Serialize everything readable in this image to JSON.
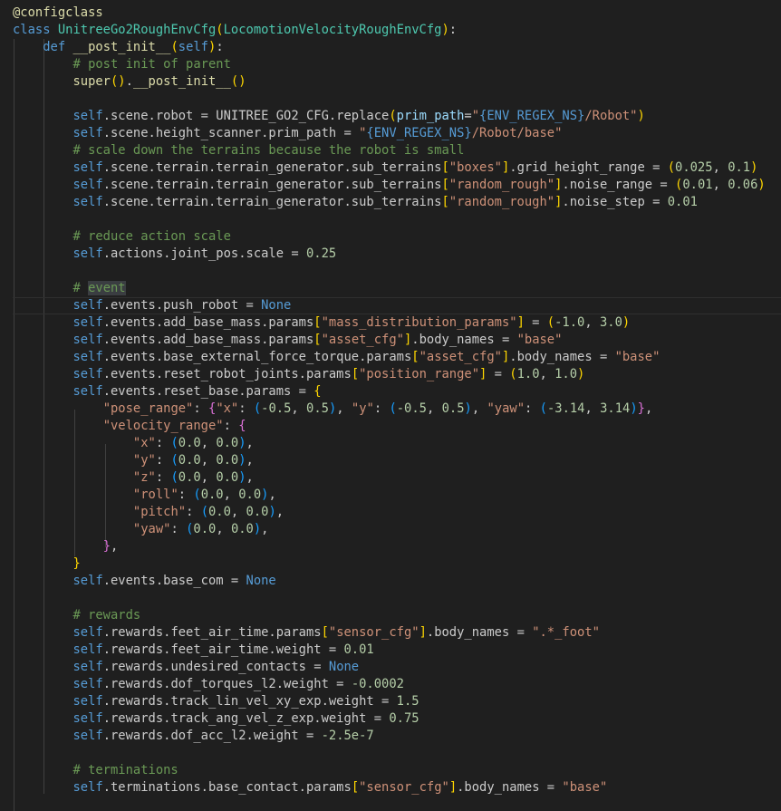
{
  "colors": {
    "background": "#1f1f1f",
    "text": "#cccccc",
    "keyword": "#569cd6",
    "class_name": "#4ec9b0",
    "function": "#dcdcaa",
    "string": "#ce9178",
    "number": "#b5cea8",
    "comment": "#6a9955",
    "bracket_1": "#ffd700",
    "bracket_2": "#da70d6",
    "bracket_3": "#179fff"
  },
  "code": {
    "language": "python",
    "highlighted_line": 17,
    "lines": [
      [
        {
          "t": "dec",
          "v": "@configclass"
        }
      ],
      [
        {
          "t": "kw",
          "v": "class "
        },
        {
          "t": "cls",
          "v": "UnitreeGo2RoughEnvCfg"
        },
        {
          "t": "p1",
          "v": "("
        },
        {
          "t": "cls",
          "v": "LocomotionVelocityRoughEnvCfg"
        },
        {
          "t": "p1",
          "v": ")"
        },
        {
          "t": "op",
          "v": ":"
        }
      ],
      [
        {
          "t": "txt",
          "v": "    "
        },
        {
          "t": "kw",
          "v": "def "
        },
        {
          "t": "fn",
          "v": "__post_init__"
        },
        {
          "t": "p1",
          "v": "("
        },
        {
          "t": "self",
          "v": "self"
        },
        {
          "t": "p1",
          "v": ")"
        },
        {
          "t": "op",
          "v": ":"
        }
      ],
      [
        {
          "t": "txt",
          "v": "        "
        },
        {
          "t": "cmt",
          "v": "# post init of parent"
        }
      ],
      [
        {
          "t": "txt",
          "v": "        "
        },
        {
          "t": "fn",
          "v": "super"
        },
        {
          "t": "p1",
          "v": "()"
        },
        {
          "t": "op",
          "v": "."
        },
        {
          "t": "fn",
          "v": "__post_init__"
        },
        {
          "t": "p1",
          "v": "()"
        }
      ],
      [],
      [
        {
          "t": "txt",
          "v": "        "
        },
        {
          "t": "self",
          "v": "self"
        },
        {
          "t": "txt",
          "v": ".scene.robot = UNITREE_GO2_CFG.replace"
        },
        {
          "t": "p1",
          "v": "("
        },
        {
          "t": "param",
          "v": "prim_path"
        },
        {
          "t": "op",
          "v": "="
        },
        {
          "t": "str",
          "v": "\""
        },
        {
          "t": "esc",
          "v": "{ENV_REGEX_NS}"
        },
        {
          "t": "str",
          "v": "/Robot\""
        },
        {
          "t": "p1",
          "v": ")"
        }
      ],
      [
        {
          "t": "txt",
          "v": "        "
        },
        {
          "t": "self",
          "v": "self"
        },
        {
          "t": "txt",
          "v": ".scene.height_scanner.prim_path = "
        },
        {
          "t": "str",
          "v": "\""
        },
        {
          "t": "esc",
          "v": "{ENV_REGEX_NS}"
        },
        {
          "t": "str",
          "v": "/Robot/base\""
        }
      ],
      [
        {
          "t": "txt",
          "v": "        "
        },
        {
          "t": "cmt",
          "v": "# scale down the terrains because the robot is small"
        }
      ],
      [
        {
          "t": "txt",
          "v": "        "
        },
        {
          "t": "self",
          "v": "self"
        },
        {
          "t": "txt",
          "v": ".scene.terrain.terrain_generator.sub_terrains"
        },
        {
          "t": "p1",
          "v": "["
        },
        {
          "t": "str",
          "v": "\"boxes\""
        },
        {
          "t": "p1",
          "v": "]"
        },
        {
          "t": "txt",
          "v": ".grid_height_range = "
        },
        {
          "t": "p1",
          "v": "("
        },
        {
          "t": "num",
          "v": "0.025"
        },
        {
          "t": "txt",
          "v": ", "
        },
        {
          "t": "num",
          "v": "0.1"
        },
        {
          "t": "p1",
          "v": ")"
        }
      ],
      [
        {
          "t": "txt",
          "v": "        "
        },
        {
          "t": "self",
          "v": "self"
        },
        {
          "t": "txt",
          "v": ".scene.terrain.terrain_generator.sub_terrains"
        },
        {
          "t": "p1",
          "v": "["
        },
        {
          "t": "str",
          "v": "\"random_rough\""
        },
        {
          "t": "p1",
          "v": "]"
        },
        {
          "t": "txt",
          "v": ".noise_range = "
        },
        {
          "t": "p1",
          "v": "("
        },
        {
          "t": "num",
          "v": "0.01"
        },
        {
          "t": "txt",
          "v": ", "
        },
        {
          "t": "num",
          "v": "0.06"
        },
        {
          "t": "p1",
          "v": ")"
        }
      ],
      [
        {
          "t": "txt",
          "v": "        "
        },
        {
          "t": "self",
          "v": "self"
        },
        {
          "t": "txt",
          "v": ".scene.terrain.terrain_generator.sub_terrains"
        },
        {
          "t": "p1",
          "v": "["
        },
        {
          "t": "str",
          "v": "\"random_rough\""
        },
        {
          "t": "p1",
          "v": "]"
        },
        {
          "t": "txt",
          "v": ".noise_step = "
        },
        {
          "t": "num",
          "v": "0.01"
        }
      ],
      [],
      [
        {
          "t": "txt",
          "v": "        "
        },
        {
          "t": "cmt",
          "v": "# reduce action scale"
        }
      ],
      [
        {
          "t": "txt",
          "v": "        "
        },
        {
          "t": "self",
          "v": "self"
        },
        {
          "t": "txt",
          "v": ".actions.joint_pos.scale = "
        },
        {
          "t": "num",
          "v": "0.25"
        }
      ],
      [],
      [
        {
          "t": "txt",
          "v": "        "
        },
        {
          "t": "cmt",
          "v": "# "
        },
        {
          "t": "cmthl",
          "v": "event"
        }
      ],
      [
        {
          "t": "txt",
          "v": "        "
        },
        {
          "t": "self",
          "v": "self"
        },
        {
          "t": "txt",
          "v": ".events.push_robot = "
        },
        {
          "t": "kw",
          "v": "None"
        }
      ],
      [
        {
          "t": "txt",
          "v": "        "
        },
        {
          "t": "self",
          "v": "self"
        },
        {
          "t": "txt",
          "v": ".events.add_base_mass.params"
        },
        {
          "t": "p1",
          "v": "["
        },
        {
          "t": "str",
          "v": "\"mass_distribution_params\""
        },
        {
          "t": "p1",
          "v": "]"
        },
        {
          "t": "txt",
          "v": " = "
        },
        {
          "t": "p1",
          "v": "("
        },
        {
          "t": "num",
          "v": "-1.0"
        },
        {
          "t": "txt",
          "v": ", "
        },
        {
          "t": "num",
          "v": "3.0"
        },
        {
          "t": "p1",
          "v": ")"
        }
      ],
      [
        {
          "t": "txt",
          "v": "        "
        },
        {
          "t": "self",
          "v": "self"
        },
        {
          "t": "txt",
          "v": ".events.add_base_mass.params"
        },
        {
          "t": "p1",
          "v": "["
        },
        {
          "t": "str",
          "v": "\"asset_cfg\""
        },
        {
          "t": "p1",
          "v": "]"
        },
        {
          "t": "txt",
          "v": ".body_names = "
        },
        {
          "t": "str",
          "v": "\"base\""
        }
      ],
      [
        {
          "t": "txt",
          "v": "        "
        },
        {
          "t": "self",
          "v": "self"
        },
        {
          "t": "txt",
          "v": ".events.base_external_force_torque.params"
        },
        {
          "t": "p1",
          "v": "["
        },
        {
          "t": "str",
          "v": "\"asset_cfg\""
        },
        {
          "t": "p1",
          "v": "]"
        },
        {
          "t": "txt",
          "v": ".body_names = "
        },
        {
          "t": "str",
          "v": "\"base\""
        }
      ],
      [
        {
          "t": "txt",
          "v": "        "
        },
        {
          "t": "self",
          "v": "self"
        },
        {
          "t": "txt",
          "v": ".events.reset_robot_joints.params"
        },
        {
          "t": "p1",
          "v": "["
        },
        {
          "t": "str",
          "v": "\"position_range\""
        },
        {
          "t": "p1",
          "v": "]"
        },
        {
          "t": "txt",
          "v": " = "
        },
        {
          "t": "p1",
          "v": "("
        },
        {
          "t": "num",
          "v": "1.0"
        },
        {
          "t": "txt",
          "v": ", "
        },
        {
          "t": "num",
          "v": "1.0"
        },
        {
          "t": "p1",
          "v": ")"
        }
      ],
      [
        {
          "t": "txt",
          "v": "        "
        },
        {
          "t": "self",
          "v": "self"
        },
        {
          "t": "txt",
          "v": ".events.reset_base.params = "
        },
        {
          "t": "p1",
          "v": "{"
        }
      ],
      [
        {
          "t": "txt",
          "v": "            "
        },
        {
          "t": "str",
          "v": "\"pose_range\""
        },
        {
          "t": "txt",
          "v": ": "
        },
        {
          "t": "p2",
          "v": "{"
        },
        {
          "t": "str",
          "v": "\"x\""
        },
        {
          "t": "txt",
          "v": ": "
        },
        {
          "t": "p3",
          "v": "("
        },
        {
          "t": "num",
          "v": "-0.5"
        },
        {
          "t": "txt",
          "v": ", "
        },
        {
          "t": "num",
          "v": "0.5"
        },
        {
          "t": "p3",
          "v": ")"
        },
        {
          "t": "txt",
          "v": ", "
        },
        {
          "t": "str",
          "v": "\"y\""
        },
        {
          "t": "txt",
          "v": ": "
        },
        {
          "t": "p3",
          "v": "("
        },
        {
          "t": "num",
          "v": "-0.5"
        },
        {
          "t": "txt",
          "v": ", "
        },
        {
          "t": "num",
          "v": "0.5"
        },
        {
          "t": "p3",
          "v": ")"
        },
        {
          "t": "txt",
          "v": ", "
        },
        {
          "t": "str",
          "v": "\"yaw\""
        },
        {
          "t": "txt",
          "v": ": "
        },
        {
          "t": "p3",
          "v": "("
        },
        {
          "t": "num",
          "v": "-3.14"
        },
        {
          "t": "txt",
          "v": ", "
        },
        {
          "t": "num",
          "v": "3.14"
        },
        {
          "t": "p3",
          "v": ")"
        },
        {
          "t": "p2",
          "v": "}"
        },
        {
          "t": "txt",
          "v": ","
        }
      ],
      [
        {
          "t": "txt",
          "v": "            "
        },
        {
          "t": "str",
          "v": "\"velocity_range\""
        },
        {
          "t": "txt",
          "v": ": "
        },
        {
          "t": "p2",
          "v": "{"
        }
      ],
      [
        {
          "t": "txt",
          "v": "                "
        },
        {
          "t": "str",
          "v": "\"x\""
        },
        {
          "t": "txt",
          "v": ": "
        },
        {
          "t": "p3",
          "v": "("
        },
        {
          "t": "num",
          "v": "0.0"
        },
        {
          "t": "txt",
          "v": ", "
        },
        {
          "t": "num",
          "v": "0.0"
        },
        {
          "t": "p3",
          "v": ")"
        },
        {
          "t": "txt",
          "v": ","
        }
      ],
      [
        {
          "t": "txt",
          "v": "                "
        },
        {
          "t": "str",
          "v": "\"y\""
        },
        {
          "t": "txt",
          "v": ": "
        },
        {
          "t": "p3",
          "v": "("
        },
        {
          "t": "num",
          "v": "0.0"
        },
        {
          "t": "txt",
          "v": ", "
        },
        {
          "t": "num",
          "v": "0.0"
        },
        {
          "t": "p3",
          "v": ")"
        },
        {
          "t": "txt",
          "v": ","
        }
      ],
      [
        {
          "t": "txt",
          "v": "                "
        },
        {
          "t": "str",
          "v": "\"z\""
        },
        {
          "t": "txt",
          "v": ": "
        },
        {
          "t": "p3",
          "v": "("
        },
        {
          "t": "num",
          "v": "0.0"
        },
        {
          "t": "txt",
          "v": ", "
        },
        {
          "t": "num",
          "v": "0.0"
        },
        {
          "t": "p3",
          "v": ")"
        },
        {
          "t": "txt",
          "v": ","
        }
      ],
      [
        {
          "t": "txt",
          "v": "                "
        },
        {
          "t": "str",
          "v": "\"roll\""
        },
        {
          "t": "txt",
          "v": ": "
        },
        {
          "t": "p3",
          "v": "("
        },
        {
          "t": "num",
          "v": "0.0"
        },
        {
          "t": "txt",
          "v": ", "
        },
        {
          "t": "num",
          "v": "0.0"
        },
        {
          "t": "p3",
          "v": ")"
        },
        {
          "t": "txt",
          "v": ","
        }
      ],
      [
        {
          "t": "txt",
          "v": "                "
        },
        {
          "t": "str",
          "v": "\"pitch\""
        },
        {
          "t": "txt",
          "v": ": "
        },
        {
          "t": "p3",
          "v": "("
        },
        {
          "t": "num",
          "v": "0.0"
        },
        {
          "t": "txt",
          "v": ", "
        },
        {
          "t": "num",
          "v": "0.0"
        },
        {
          "t": "p3",
          "v": ")"
        },
        {
          "t": "txt",
          "v": ","
        }
      ],
      [
        {
          "t": "txt",
          "v": "                "
        },
        {
          "t": "str",
          "v": "\"yaw\""
        },
        {
          "t": "txt",
          "v": ": "
        },
        {
          "t": "p3",
          "v": "("
        },
        {
          "t": "num",
          "v": "0.0"
        },
        {
          "t": "txt",
          "v": ", "
        },
        {
          "t": "num",
          "v": "0.0"
        },
        {
          "t": "p3",
          "v": ")"
        },
        {
          "t": "txt",
          "v": ","
        }
      ],
      [
        {
          "t": "txt",
          "v": "            "
        },
        {
          "t": "p2",
          "v": "}"
        },
        {
          "t": "txt",
          "v": ","
        }
      ],
      [
        {
          "t": "txt",
          "v": "        "
        },
        {
          "t": "p1",
          "v": "}"
        }
      ],
      [
        {
          "t": "txt",
          "v": "        "
        },
        {
          "t": "self",
          "v": "self"
        },
        {
          "t": "txt",
          "v": ".events.base_com = "
        },
        {
          "t": "kw",
          "v": "None"
        }
      ],
      [],
      [
        {
          "t": "txt",
          "v": "        "
        },
        {
          "t": "cmt",
          "v": "# rewards"
        }
      ],
      [
        {
          "t": "txt",
          "v": "        "
        },
        {
          "t": "self",
          "v": "self"
        },
        {
          "t": "txt",
          "v": ".rewards.feet_air_time.params"
        },
        {
          "t": "p1",
          "v": "["
        },
        {
          "t": "str",
          "v": "\"sensor_cfg\""
        },
        {
          "t": "p1",
          "v": "]"
        },
        {
          "t": "txt",
          "v": ".body_names = "
        },
        {
          "t": "str",
          "v": "\".*_foot\""
        }
      ],
      [
        {
          "t": "txt",
          "v": "        "
        },
        {
          "t": "self",
          "v": "self"
        },
        {
          "t": "txt",
          "v": ".rewards.feet_air_time.weight = "
        },
        {
          "t": "num",
          "v": "0.01"
        }
      ],
      [
        {
          "t": "txt",
          "v": "        "
        },
        {
          "t": "self",
          "v": "self"
        },
        {
          "t": "txt",
          "v": ".rewards.undesired_contacts = "
        },
        {
          "t": "kw",
          "v": "None"
        }
      ],
      [
        {
          "t": "txt",
          "v": "        "
        },
        {
          "t": "self",
          "v": "self"
        },
        {
          "t": "txt",
          "v": ".rewards.dof_torques_l2.weight = "
        },
        {
          "t": "num",
          "v": "-0.0002"
        }
      ],
      [
        {
          "t": "txt",
          "v": "        "
        },
        {
          "t": "self",
          "v": "self"
        },
        {
          "t": "txt",
          "v": ".rewards.track_lin_vel_xy_exp.weight = "
        },
        {
          "t": "num",
          "v": "1.5"
        }
      ],
      [
        {
          "t": "txt",
          "v": "        "
        },
        {
          "t": "self",
          "v": "self"
        },
        {
          "t": "txt",
          "v": ".rewards.track_ang_vel_z_exp.weight = "
        },
        {
          "t": "num",
          "v": "0.75"
        }
      ],
      [
        {
          "t": "txt",
          "v": "        "
        },
        {
          "t": "self",
          "v": "self"
        },
        {
          "t": "txt",
          "v": ".rewards.dof_acc_l2.weight = "
        },
        {
          "t": "num",
          "v": "-2.5e-7"
        }
      ],
      [],
      [
        {
          "t": "txt",
          "v": "        "
        },
        {
          "t": "cmt",
          "v": "# terminations"
        }
      ],
      [
        {
          "t": "txt",
          "v": "        "
        },
        {
          "t": "self",
          "v": "self"
        },
        {
          "t": "txt",
          "v": ".terminations.base_contact.params"
        },
        {
          "t": "p1",
          "v": "["
        },
        {
          "t": "str",
          "v": "\"sensor_cfg\""
        },
        {
          "t": "p1",
          "v": "]"
        },
        {
          "t": "txt",
          "v": ".body_names = "
        },
        {
          "t": "str",
          "v": "\"base\""
        }
      ]
    ]
  }
}
